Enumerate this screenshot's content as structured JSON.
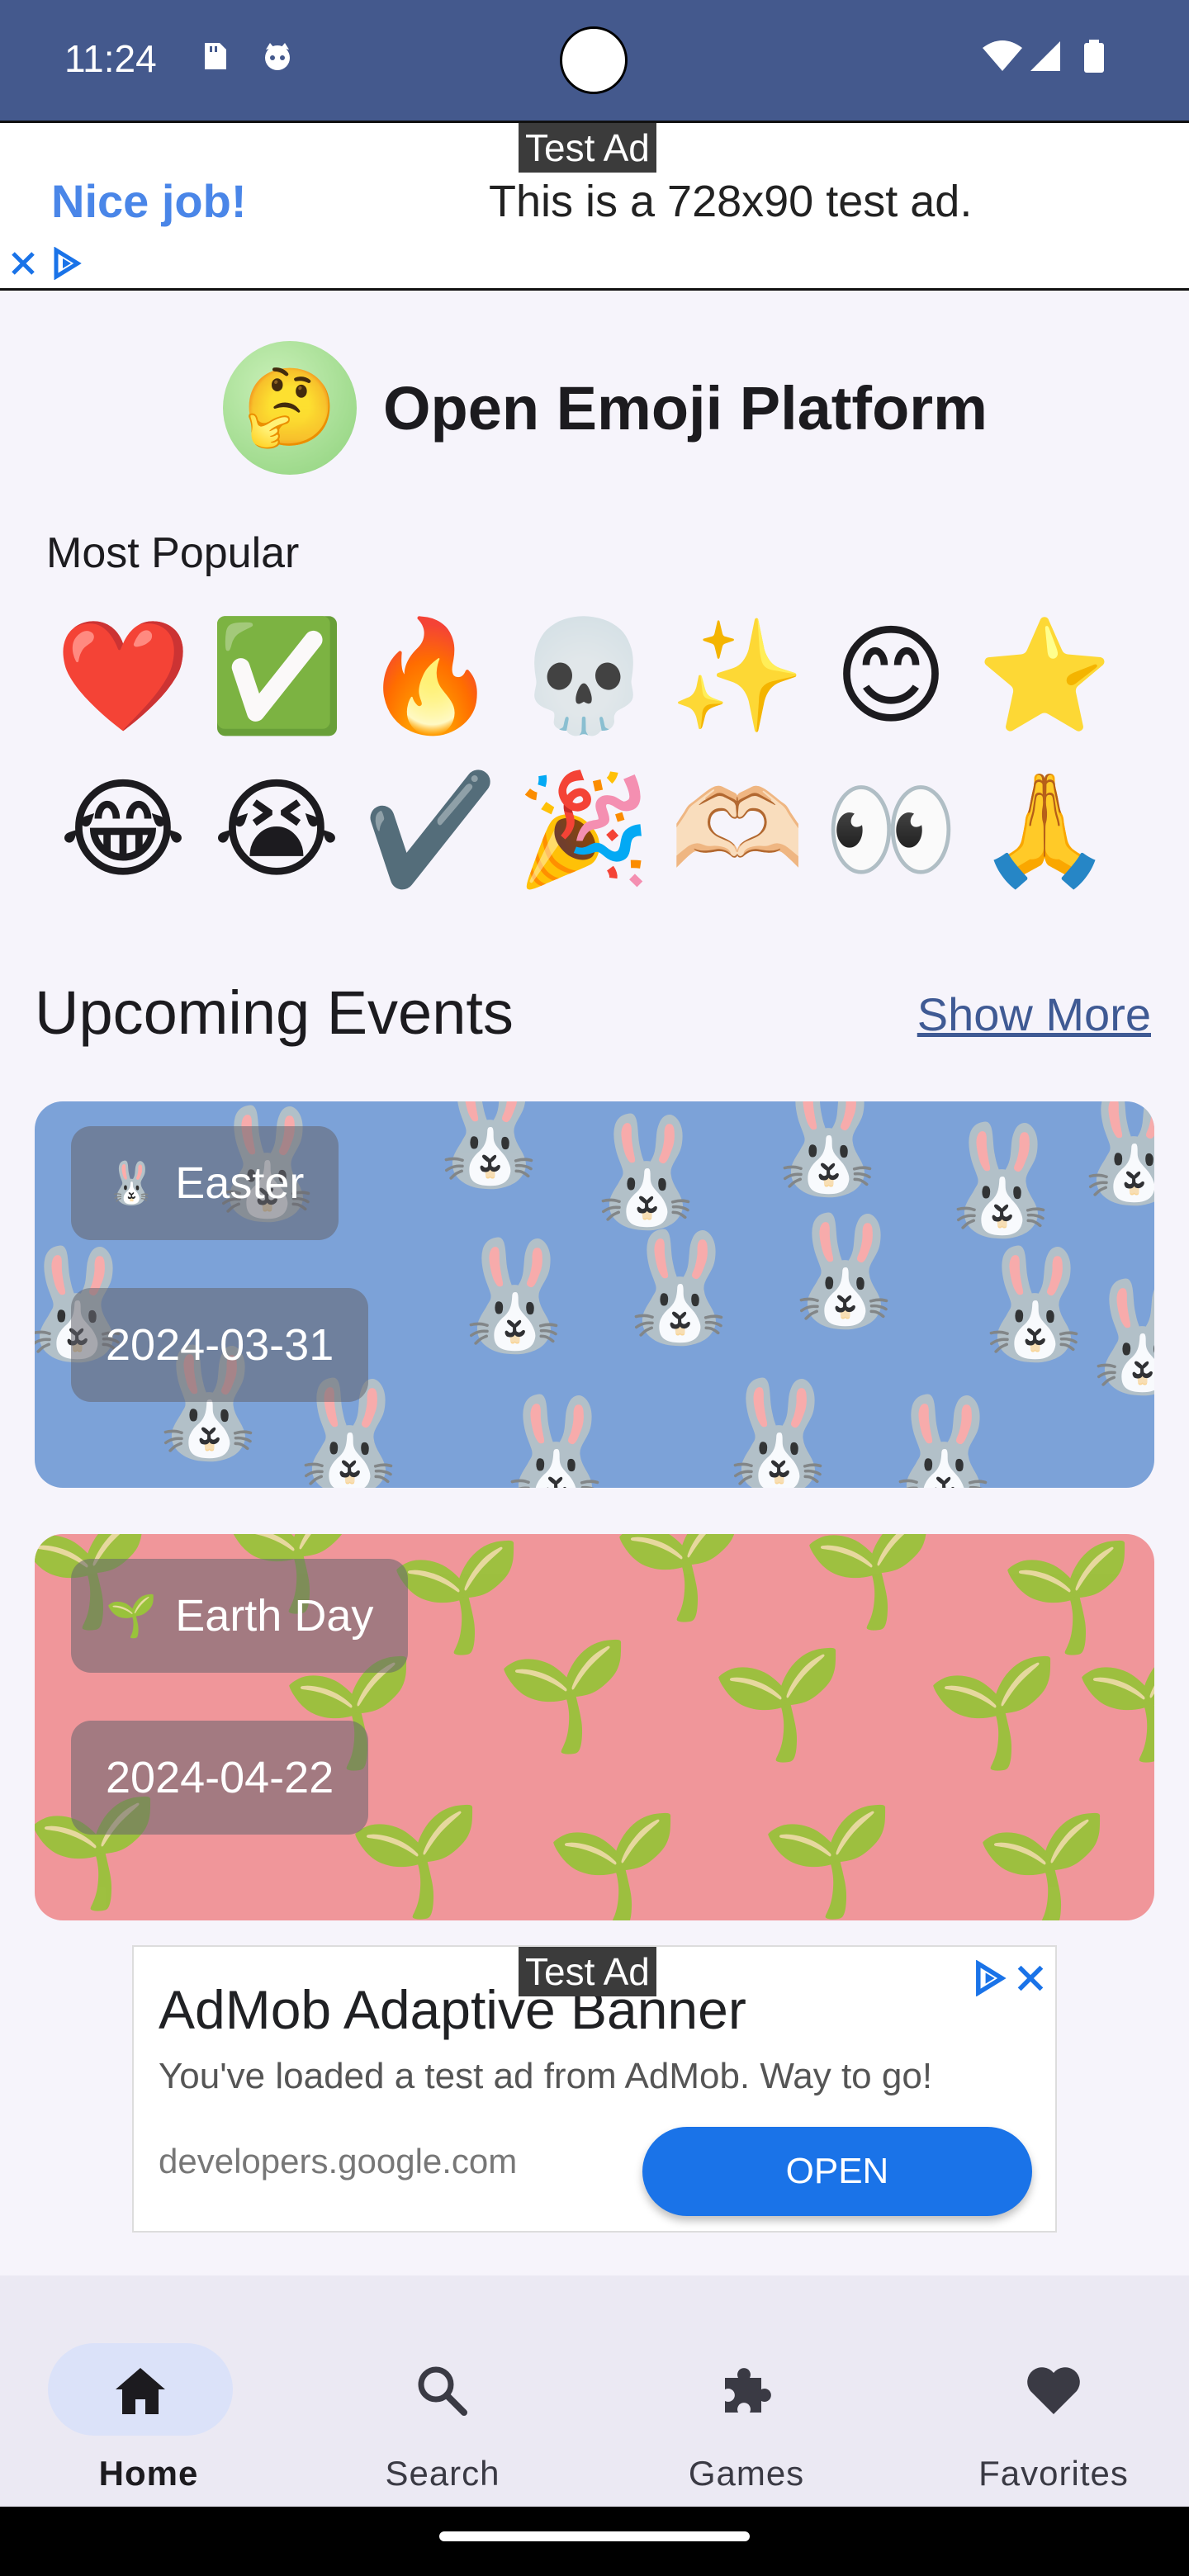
{
  "status_bar": {
    "time": "11:24",
    "icons": [
      "sd-card-icon",
      "cat-face-icon",
      "wifi-icon",
      "signal-icon",
      "battery-icon"
    ]
  },
  "top_ad": {
    "badge": "Test Ad",
    "headline": "Nice job!",
    "body": "This is a 728x90 test ad.",
    "icons": [
      "close-icon",
      "ad-choices-icon"
    ]
  },
  "header": {
    "logo_emoji": "🤔",
    "title": "Open Emoji Platform"
  },
  "popular": {
    "label": "Most Popular",
    "emojis": [
      "❤️",
      "✅",
      "🔥",
      "💀",
      "✨",
      "😊",
      "⭐",
      "😂",
      "😭",
      "✔️",
      "🎉",
      "🫶🏻",
      "👀",
      "🙏"
    ]
  },
  "events": {
    "title": "Upcoming Events",
    "show_more": "Show More",
    "items": [
      {
        "icon": "🐰",
        "name": "Easter",
        "date": "2024-03-31",
        "color": "#7ca2d8"
      },
      {
        "icon": "🌱",
        "name": "Earth Day",
        "date": "2024-04-22",
        "color": "#f0969a"
      }
    ]
  },
  "admob": {
    "badge": "Test Ad",
    "title": "AdMob Adaptive Banner",
    "subtitle": "You've loaded a test ad from AdMob. Way to go!",
    "domain": "developers.google.com",
    "button": "OPEN"
  },
  "nav": {
    "items": [
      {
        "label": "Home",
        "icon": "home-icon",
        "active": true
      },
      {
        "label": "Search",
        "icon": "search-icon",
        "active": false
      },
      {
        "label": "Games",
        "icon": "puzzle-icon",
        "active": false
      },
      {
        "label": "Favorites",
        "icon": "heart-icon",
        "active": false
      }
    ]
  },
  "colors": {
    "status_bar": "#44598d",
    "link": "#3f5a94",
    "ad_blue": "#1a73e8",
    "nav_active": "#dbe2f9"
  }
}
